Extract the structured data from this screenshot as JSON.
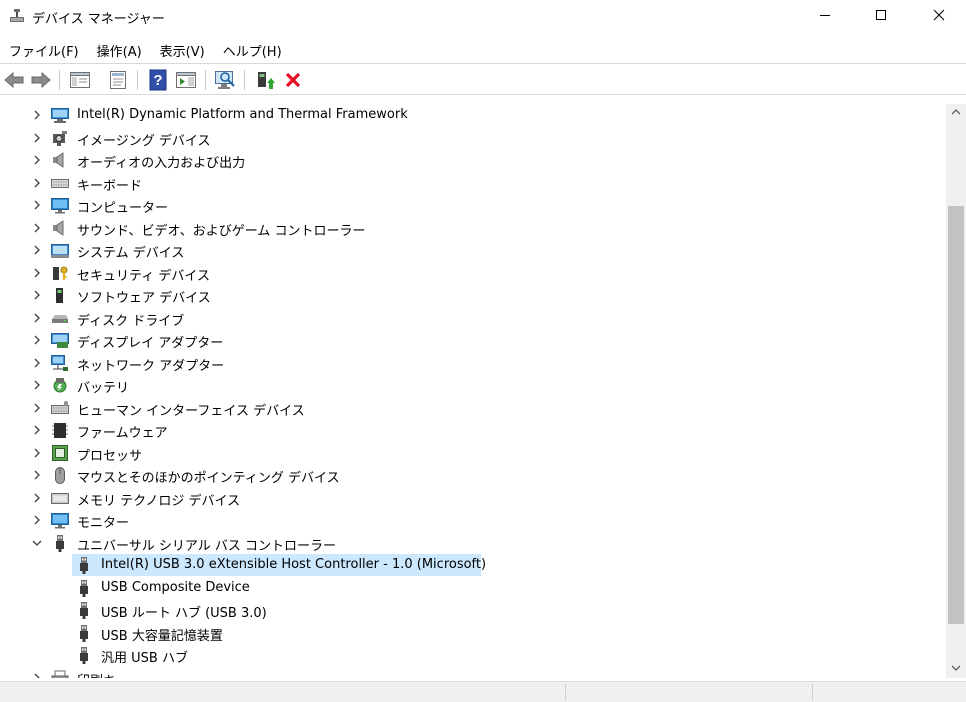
{
  "window": {
    "title": "デバイス マネージャー"
  },
  "menu": [
    {
      "label": "ファイル(F)"
    },
    {
      "label": "操作(A)"
    },
    {
      "label": "表示(V)"
    },
    {
      "label": "ヘルプ(H)"
    }
  ],
  "toolbar_icons": [
    "back-arrow-icon",
    "forward-arrow-icon",
    "show-hide-tree-icon",
    "properties-icon",
    "help-icon",
    "action-pane-icon",
    "scan-hardware-icon",
    "update-driver-icon",
    "uninstall-device-icon"
  ],
  "tree": [
    {
      "label": "Intel(R) Dynamic Platform and Thermal Framework",
      "icon": "computer-icon",
      "level": 0,
      "expanded": false
    },
    {
      "label": "イメージング デバイス",
      "icon": "camera-icon",
      "level": 0,
      "expanded": false
    },
    {
      "label": "オーディオの入力および出力",
      "icon": "speaker-icon",
      "level": 0,
      "expanded": false
    },
    {
      "label": "キーボード",
      "icon": "keyboard-icon",
      "level": 0,
      "expanded": false
    },
    {
      "label": "コンピューター",
      "icon": "monitor-icon",
      "level": 0,
      "expanded": false
    },
    {
      "label": "サウンド、ビデオ、およびゲーム コントローラー",
      "icon": "speaker-icon",
      "level": 0,
      "expanded": false
    },
    {
      "label": "システム デバイス",
      "icon": "folder-device-icon",
      "level": 0,
      "expanded": false
    },
    {
      "label": "セキュリティ デバイス",
      "icon": "key-icon",
      "level": 0,
      "expanded": false
    },
    {
      "label": "ソフトウェア デバイス",
      "icon": "software-device-icon",
      "level": 0,
      "expanded": false
    },
    {
      "label": "ディスク ドライブ",
      "icon": "disk-drive-icon",
      "level": 0,
      "expanded": false
    },
    {
      "label": "ディスプレイ アダプター",
      "icon": "display-adapter-icon",
      "level": 0,
      "expanded": false
    },
    {
      "label": "ネットワーク アダプター",
      "icon": "network-icon",
      "level": 0,
      "expanded": false
    },
    {
      "label": "バッテリ",
      "icon": "battery-icon",
      "level": 0,
      "expanded": false
    },
    {
      "label": "ヒューマン インターフェイス デバイス",
      "icon": "hid-icon",
      "level": 0,
      "expanded": false
    },
    {
      "label": "ファームウェア",
      "icon": "firmware-icon",
      "level": 0,
      "expanded": false
    },
    {
      "label": "プロセッサ",
      "icon": "processor-icon",
      "level": 0,
      "expanded": false
    },
    {
      "label": "マウスとそのほかのポインティング デバイス",
      "icon": "mouse-icon",
      "level": 0,
      "expanded": false
    },
    {
      "label": "メモリ テクノロジ デバイス",
      "icon": "memory-icon",
      "level": 0,
      "expanded": false
    },
    {
      "label": "モニター",
      "icon": "monitor-icon",
      "level": 0,
      "expanded": false
    },
    {
      "label": "ユニバーサル シリアル バス コントローラー",
      "icon": "usb-icon",
      "level": 0,
      "expanded": true
    },
    {
      "label": "Intel(R) USB 3.0 eXtensible Host Controller - 1.0 (Microsoft)",
      "icon": "usb-icon",
      "level": 1,
      "selected": true
    },
    {
      "label": "USB Composite Device",
      "icon": "usb-icon",
      "level": 1
    },
    {
      "label": "USB ルート ハブ (USB 3.0)",
      "icon": "usb-icon",
      "level": 1
    },
    {
      "label": "USB 大容量記憶装置",
      "icon": "usb-icon",
      "level": 1
    },
    {
      "label": "汎用 USB ハブ",
      "icon": "usb-icon",
      "level": 1
    },
    {
      "label": "印刷キュー",
      "icon": "printer-icon",
      "level": 0,
      "expanded": false
    }
  ],
  "colors": {
    "selection": "#cce8ff",
    "accent": "#0078d7",
    "delete_red": "#e81123"
  }
}
